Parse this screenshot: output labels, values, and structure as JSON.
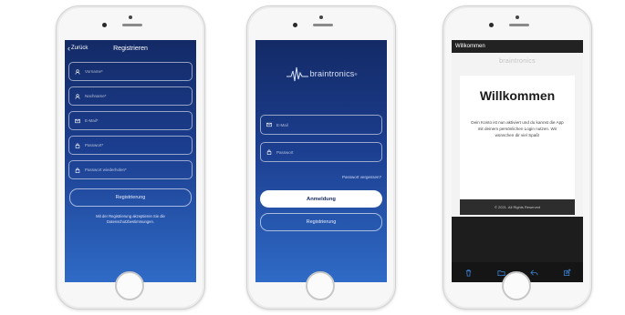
{
  "register": {
    "back_label": "Zurück",
    "title": "Registrieren",
    "fields": [
      {
        "placeholder": "Vorname*",
        "icon": "person-icon"
      },
      {
        "placeholder": "Nachname*",
        "icon": "person-icon"
      },
      {
        "placeholder": "E-Mail*",
        "icon": "mail-icon"
      },
      {
        "placeholder": "Passwort*",
        "icon": "lock-icon"
      },
      {
        "placeholder": "Passwort wiederholen*",
        "icon": "lock-icon"
      }
    ],
    "submit_label": "Registrierung",
    "note_line1": "Mit der Registrierung akzeptieren Sie die",
    "note_line2": "Datenschutzbestimmungen."
  },
  "login": {
    "brand": "braintronics",
    "fields": [
      {
        "placeholder": "E-Mail",
        "icon": "mail-icon"
      },
      {
        "placeholder": "Passwort",
        "icon": "lock-icon"
      }
    ],
    "forgot_label": "Passwort vergessen?",
    "login_label": "Anmeldung",
    "register_label": "Registrierung"
  },
  "welcome": {
    "window_title": "Willkommen",
    "ghost_logo": "braintronics",
    "heading": "Willkommen",
    "message": "Dein Konto ist nun aktiviert und du kannst die App mit deinem persönlichen Login nutzen. Wir wünschen dir viel Spaß!",
    "footer": "© 2021. All Rights Reserved",
    "toolbar_icons": [
      "trash-icon",
      "folder-icon",
      "reply-icon",
      "compose-icon"
    ]
  },
  "colors": {
    "screen_gradient_top": "#132a66",
    "screen_gradient_bottom": "#2f6bc7",
    "login_button": "#ffffff"
  }
}
